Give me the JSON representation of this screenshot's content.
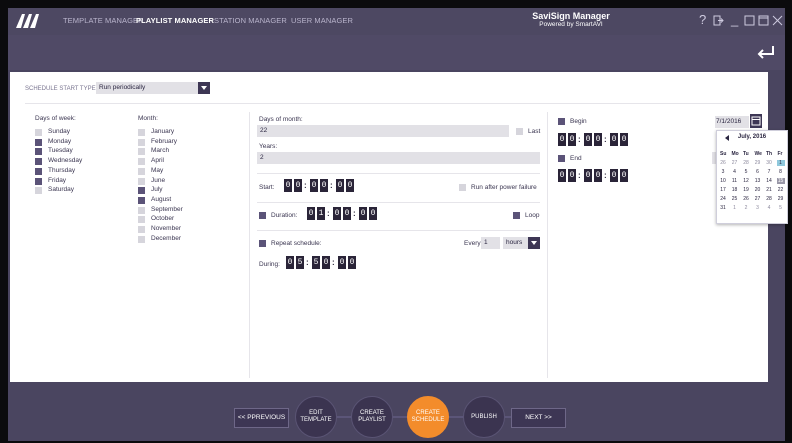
{
  "header": {
    "logo_text": "AVI",
    "tabs": [
      {
        "label": "TEMPLATE MANAGER",
        "active": false
      },
      {
        "label": "PLAYLIST MANAGER",
        "active": true
      },
      {
        "label": "STATION MANAGER",
        "active": false
      },
      {
        "label": "USER MANAGER",
        "active": false
      }
    ],
    "title": "SaviSign Manager",
    "subtitle": "Powered by SmartAVI",
    "window_buttons": [
      "help-icon",
      "logout-icon",
      "minimize-icon",
      "maximize-icon",
      "close-icon"
    ]
  },
  "schedule": {
    "start_type_label": "SCHEDULE START TYPE:",
    "start_type_value": "Run periodically",
    "days_of_week": {
      "label": "Days of week:",
      "items": [
        {
          "label": "Sunday",
          "checked": false
        },
        {
          "label": "Monday",
          "checked": true
        },
        {
          "label": "Tuesday",
          "checked": true
        },
        {
          "label": "Wednesday",
          "checked": true
        },
        {
          "label": "Thursday",
          "checked": true
        },
        {
          "label": "Friday",
          "checked": true
        },
        {
          "label": "Saturday",
          "checked": false
        }
      ]
    },
    "month": {
      "label": "Month:",
      "items": [
        {
          "label": "January",
          "checked": false
        },
        {
          "label": "February",
          "checked": false
        },
        {
          "label": "March",
          "checked": false
        },
        {
          "label": "April",
          "checked": false
        },
        {
          "label": "May",
          "checked": false
        },
        {
          "label": "June",
          "checked": false
        },
        {
          "label": "July",
          "checked": true
        },
        {
          "label": "August",
          "checked": true
        },
        {
          "label": "September",
          "checked": false
        },
        {
          "label": "October",
          "checked": false
        },
        {
          "label": "November",
          "checked": false
        },
        {
          "label": "December",
          "checked": false
        }
      ]
    },
    "days_of_month": {
      "label": "Days of month:",
      "value": "22",
      "last_label": "Last"
    },
    "years": {
      "label": "Years:",
      "value": "2"
    },
    "start": {
      "label": "Start:",
      "time": [
        "0",
        "0",
        "0",
        "0",
        "0",
        "0"
      ]
    },
    "run_after_power_failure": {
      "label": "Run after power failure",
      "checked": false
    },
    "duration": {
      "label": "Duration:",
      "checked": true,
      "time": [
        "0",
        "1",
        "0",
        "0",
        "0",
        "0"
      ]
    },
    "loop": {
      "label": "Loop",
      "checked": true
    },
    "repeat": {
      "label": "Repeat schedule:",
      "checked": true,
      "every_label": "Every",
      "every_value": "1",
      "unit": "hours"
    },
    "during": {
      "label": "During:",
      "time": [
        "0",
        "5",
        "5",
        "0",
        "0",
        "0"
      ]
    },
    "begin": {
      "label": "Begin",
      "checked": true,
      "time": [
        "0",
        "0",
        "0",
        "0",
        "0",
        "0"
      ],
      "date": "7/1/2016"
    },
    "end": {
      "label": "End",
      "checked": true,
      "time": [
        "0",
        "0",
        "0",
        "0",
        "0",
        "0"
      ]
    }
  },
  "calendar": {
    "title": "July, 2016",
    "dow": [
      "Su",
      "Mo",
      "Tu",
      "We",
      "Th",
      "Fr"
    ],
    "rows": [
      [
        "26",
        "27",
        "28",
        "29",
        "30",
        "1"
      ],
      [
        "3",
        "4",
        "5",
        "6",
        "7",
        "8"
      ],
      [
        "10",
        "11",
        "12",
        "13",
        "14",
        "15"
      ],
      [
        "17",
        "18",
        "19",
        "20",
        "21",
        "22"
      ],
      [
        "24",
        "25",
        "26",
        "27",
        "28",
        "29"
      ],
      [
        "31",
        "1",
        "2",
        "3",
        "4",
        "5"
      ]
    ]
  },
  "footer": {
    "prev_label": "<< PPREVIOUS",
    "next_label": "NEXT >>",
    "steps": [
      {
        "label": "EDIT TEMPLATE",
        "active": false
      },
      {
        "label": "CREATE PLAYLIST",
        "active": false
      },
      {
        "label": "CREATE SCHEDULE",
        "active": true
      },
      {
        "label": "PUBLISH",
        "active": false
      }
    ]
  },
  "colors": {
    "accent": "#f38c2b",
    "header": "#4d4862",
    "checkbox_on": "#5b5378",
    "calendar_selected": "#8fc8dc"
  }
}
